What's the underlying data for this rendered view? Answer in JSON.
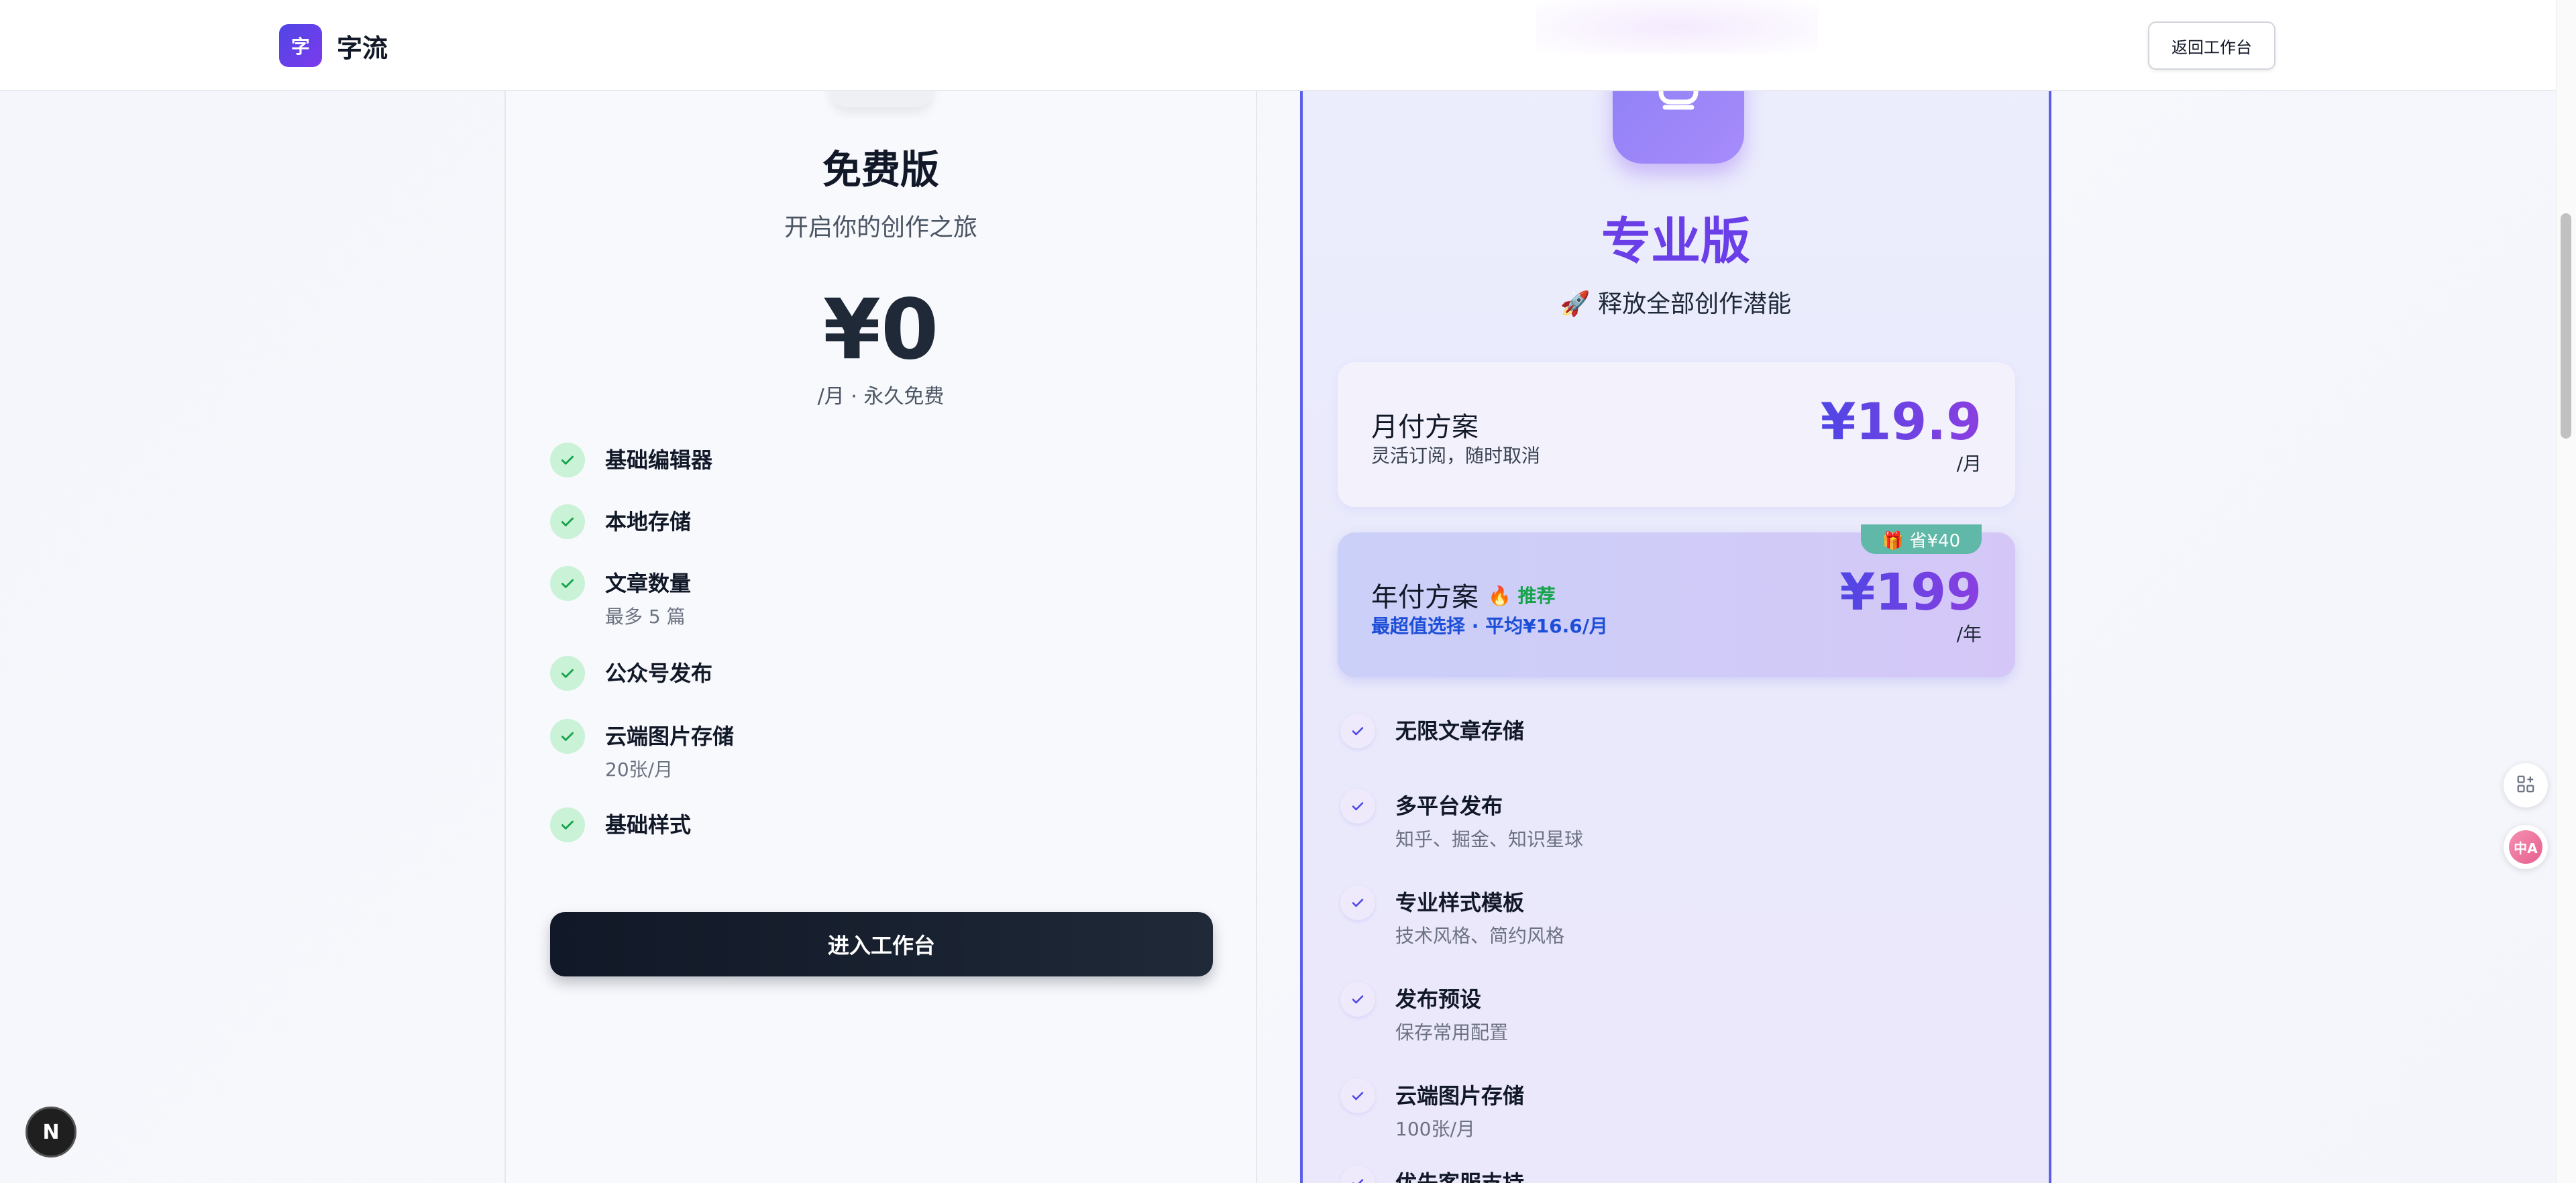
{
  "header": {
    "logo_char": "字",
    "brand": "字流",
    "back_label": "返回工作台"
  },
  "free": {
    "title": "免费版",
    "subtitle": "开启你的创作之旅",
    "price": "¥0",
    "period": "/月 · 永久免费",
    "features": [
      {
        "title": "基础编辑器",
        "note": ""
      },
      {
        "title": "本地存储",
        "note": ""
      },
      {
        "title": "文章数量",
        "note": "最多 5 篇"
      },
      {
        "title": "公众号发布",
        "note": ""
      },
      {
        "title": "云端图片存储",
        "note": "20张/月"
      },
      {
        "title": "基础样式",
        "note": ""
      }
    ],
    "cta": "进入工作台"
  },
  "pro": {
    "title": "专业版",
    "subtitle": "🚀 释放全部创作潜能",
    "monthly": {
      "name": "月付方案",
      "desc": "灵活订阅，随时取消",
      "price": "¥19.9",
      "unit": "/月"
    },
    "yearly": {
      "name": "年付方案",
      "badge": "🔥 推荐",
      "desc": "最超值选择 · 平均¥16.6/月",
      "price": "¥199",
      "unit": "/年",
      "save": "🎁 省¥40"
    },
    "features": [
      {
        "title": "无限文章存储",
        "note": ""
      },
      {
        "title": "多平台发布",
        "note": "知乎、掘金、知识星球"
      },
      {
        "title": "专业样式模板",
        "note": "技术风格、简约风格"
      },
      {
        "title": "发布预设",
        "note": "保存常用配置"
      },
      {
        "title": "云端图片存储",
        "note": "100张/月"
      },
      {
        "title": "优先客服支持",
        "note": ""
      }
    ]
  },
  "floating": {
    "translate_label": "中A"
  },
  "next_logo": "N",
  "colors": {
    "accent": "#5b5ee8",
    "pro_title": "#6b3fe8",
    "check_green": "#16a34a",
    "check_blue": "#4f46e5"
  }
}
